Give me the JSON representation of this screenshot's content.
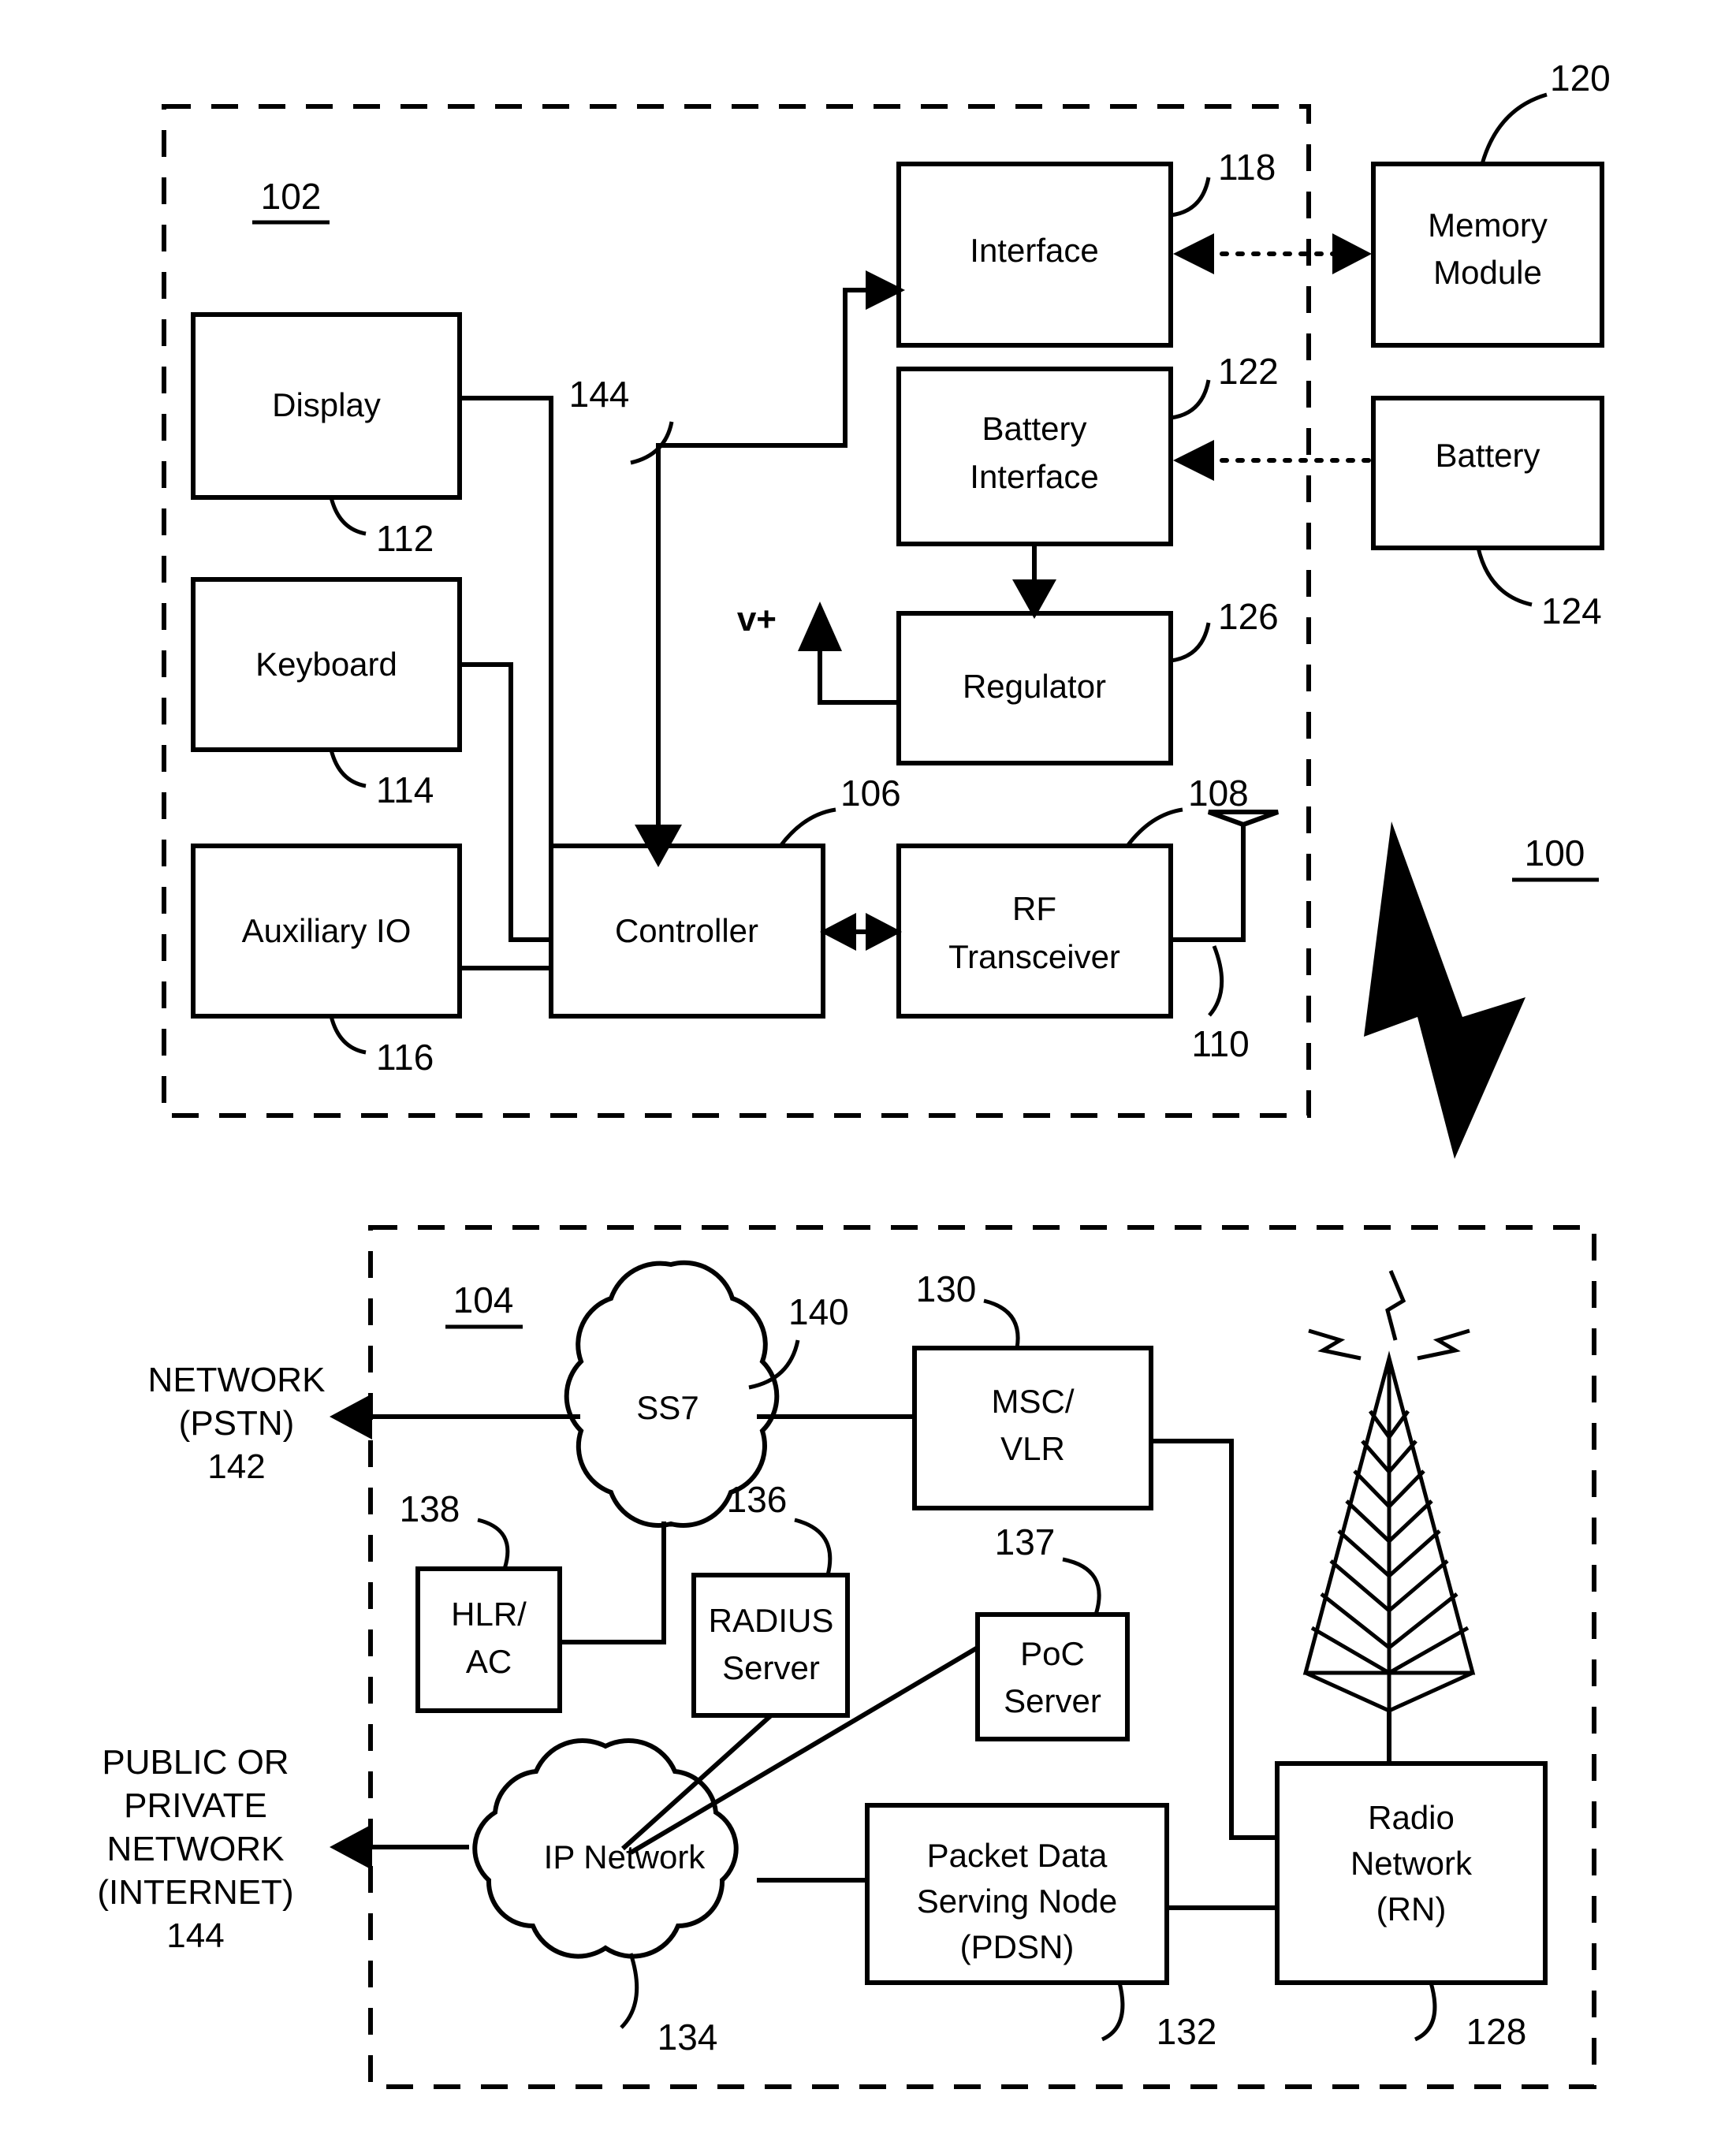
{
  "figure": {
    "system_ref": "100",
    "device_region_ref": "102",
    "network_region_ref": "104"
  },
  "device": {
    "blocks": [
      {
        "id": "display",
        "label": "Display",
        "ref": "112"
      },
      {
        "id": "keyboard",
        "label": "Keyboard",
        "ref": "114"
      },
      {
        "id": "auxiliary_io",
        "label": "Auxiliary IO",
        "ref": "116"
      },
      {
        "id": "controller",
        "label": "Controller",
        "ref": "106"
      },
      {
        "id": "rf_transceiver",
        "label_line1": "RF",
        "label_line2": "Transceiver",
        "ref": "108"
      },
      {
        "id": "interface",
        "label": "Interface",
        "ref": "118"
      },
      {
        "id": "battery_interface",
        "label_line1": "Battery",
        "label_line2": "Interface",
        "ref": "122"
      },
      {
        "id": "regulator",
        "label": "Regulator",
        "ref": "126"
      }
    ],
    "antenna_ref": "110",
    "bus_ref": "144",
    "voltage_label": "v+"
  },
  "external": {
    "blocks": [
      {
        "id": "memory_module",
        "label_line1": "Memory",
        "label_line2": "Module",
        "ref": "120"
      },
      {
        "id": "battery",
        "label": "Battery",
        "ref": "124"
      }
    ]
  },
  "network": {
    "blocks": [
      {
        "id": "msc_vlr",
        "label_line1": "MSC/",
        "label_line2": "VLR",
        "ref": "130"
      },
      {
        "id": "hlr_ac",
        "label_line1": "HLR/",
        "label_line2": "AC",
        "ref": "138"
      },
      {
        "id": "radius_server",
        "label_line1": "RADIUS",
        "label_line2": "Server",
        "ref": "136"
      },
      {
        "id": "poc_server",
        "label_line1": "PoC",
        "label_line2": "Server",
        "ref": "137"
      },
      {
        "id": "pdsn",
        "label_line1": "Packet Data",
        "label_line2": "Serving Node",
        "label_line3": "(PDSN)",
        "ref": "132"
      },
      {
        "id": "radio_network",
        "label_line1": "Radio",
        "label_line2": "Network",
        "label_line3": "(RN)",
        "ref": "128"
      }
    ],
    "clouds": [
      {
        "id": "ss7",
        "label": "SS7",
        "ref": "140"
      },
      {
        "id": "ip_network",
        "label": "IP Network",
        "ref": "134"
      }
    ],
    "endpoints": [
      {
        "id": "pstn",
        "line1": "NETWORK",
        "line2": "(PSTN)",
        "line3": "142"
      },
      {
        "id": "internet",
        "line1": "PUBLIC OR",
        "line2": "PRIVATE",
        "line3": "NETWORK",
        "line4": "(INTERNET)",
        "line5": "144"
      }
    ]
  },
  "colors": {
    "ink": "#000000",
    "paper": "#ffffff"
  }
}
